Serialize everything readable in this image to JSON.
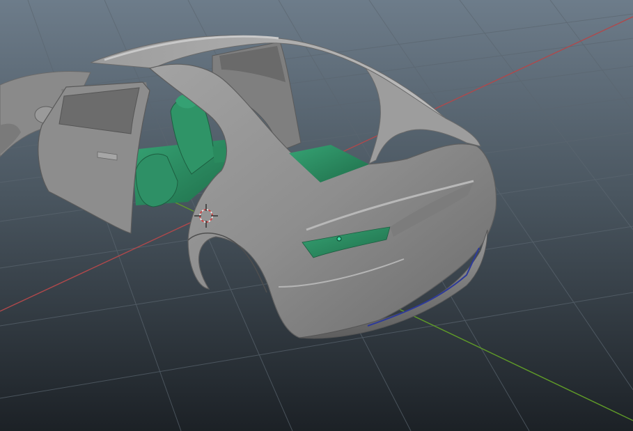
{
  "viewport": {
    "view": "perspective",
    "background_top": "#6d7c8a",
    "background_bottom": "#1c2126",
    "grid_color": "#56616b",
    "x_axis_color": "#b0484b",
    "y_axis_color": "#5f9a28"
  },
  "scene": {
    "object": "sedan car body",
    "body_color": "#8f8f8f",
    "interior_color": "#2a8a5e",
    "selection_color": "#2d3a9a",
    "doors_open": [
      "front-left",
      "rear-left"
    ],
    "gizmo": "3d-cursor"
  }
}
